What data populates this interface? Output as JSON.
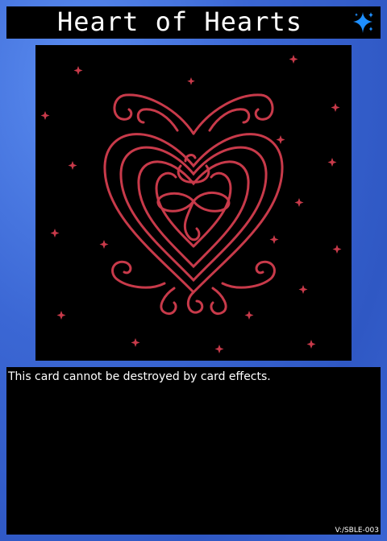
{
  "card": {
    "name": "Heart of Hearts",
    "attribute_icon": "sparkle-icon",
    "effect_text": "This card cannot be destroyed by card effects.",
    "set_code": "V:/SBLE-003"
  },
  "colors": {
    "frame": "#3b67d4",
    "panel": "#000000",
    "art_line": "#c83a4a",
    "sparkle": "#1e90ff"
  }
}
